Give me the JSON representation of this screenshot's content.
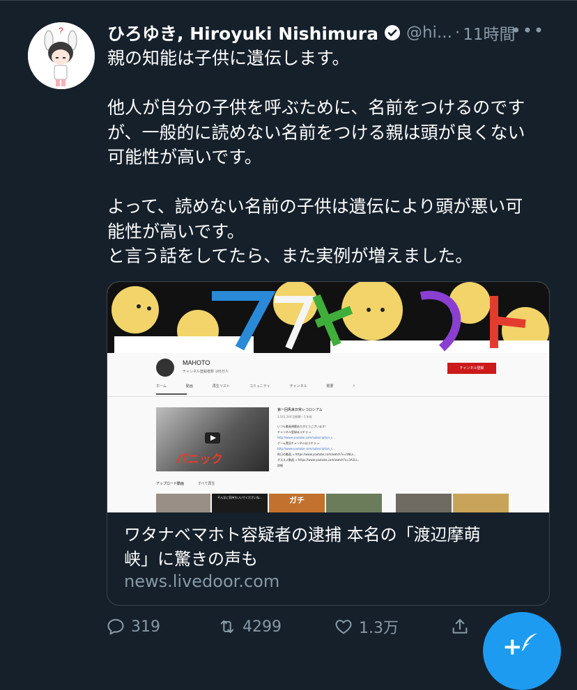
{
  "tweet": {
    "display_name": "ひろゆき, Hiroyuki Nishimura",
    "handle": "@hi...",
    "separator": "·",
    "time": "11時間",
    "more": "•••",
    "text_lines_1": [
      "親の知能は子供に遺伝します。"
    ],
    "text_lines_2": [
      "他人が自分の子供を呼ぶために、名前をつけるのです",
      "が、一般的に読めない名前をつける親は頭が良くない",
      "可能性が高いです。"
    ],
    "text_lines_3": [
      "よって、読めない名前の子供は遺伝により頭が悪い可",
      "能性が高いです。",
      "と言う話をしてたら、また実例が増えました。"
    ]
  },
  "link_card": {
    "title_line_1": "ワタナベマホト容疑者の逮捕 本名の「渡辺摩萌",
    "title_line_2": "峡」に驚きの声も",
    "domain": "news.livedoor.com",
    "preview": {
      "channel_name": "MAHOTO",
      "subscribers": "チャンネル登録者数 165万人",
      "subscribe_button": "チャンネル登録",
      "tabs": [
        "ホーム",
        "動画",
        "再生リスト",
        "コミュニティ",
        "チャンネル",
        "概要"
      ],
      "featured_title": "第一回馬来日常レコロシアム",
      "featured_meta": "3,541,244 回視聴・5 年前",
      "featured_desc": [
        "いつも動画視聴ありがとうございます！",
        "チャンネル登録はコチラ ⇒",
        "http://www.youtube.com/subscription_c...",
        "ゲーム実況チャンネルはコチラ ⇒",
        "http://www.youtube.com/subscription_c...",
        "昨日の動画 ⇒ https://www.youtube.com/watch?v=hNLa...",
        "オススメ動画 ⇒ https://www.youtube.com/watch?v=3A1LL...",
        "詳細"
      ],
      "thumb_caption": "パニック",
      "uploads_label": "アップロード動画",
      "play_all": "すべて再生",
      "thumb_small_1": "そんなに気持ちいいでくださいね...",
      "thumb_small_2": "ガチ"
    }
  },
  "actions": {
    "replies": "319",
    "retweets": "4299",
    "likes": "1.3万"
  },
  "fab": {
    "label": "+"
  },
  "colors": {
    "background": "#15202b",
    "secondary_text": "#8899a6",
    "accent": "#1d9bf0",
    "border": "#38444d"
  }
}
